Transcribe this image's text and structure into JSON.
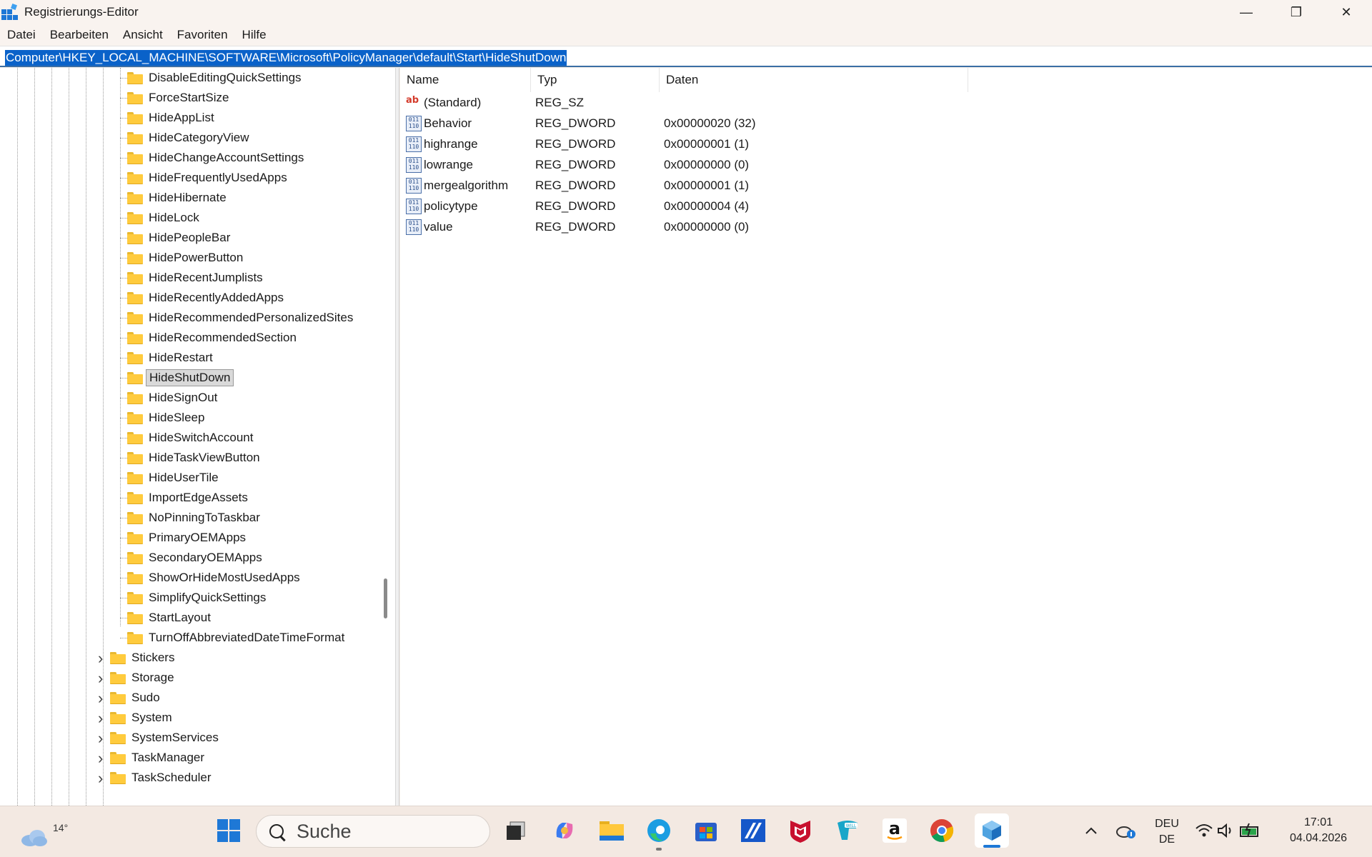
{
  "window": {
    "title": "Registrierungs-Editor",
    "controls": {
      "minimize": "—",
      "restore": "❐",
      "close": "✕"
    }
  },
  "menu": [
    "Datei",
    "Bearbeiten",
    "Ansicht",
    "Favoriten",
    "Hilfe"
  ],
  "address": "Computer\\HKEY_LOCAL_MACHINE\\SOFTWARE\\Microsoft\\PolicyManager\\default\\Start\\HideShutDown",
  "tree": {
    "children": [
      "DisableEditingQuickSettings",
      "ForceStartSize",
      "HideAppList",
      "HideCategoryView",
      "HideChangeAccountSettings",
      "HideFrequentlyUsedApps",
      "HideHibernate",
      "HideLock",
      "HidePeopleBar",
      "HidePowerButton",
      "HideRecentJumplists",
      "HideRecentlyAddedApps",
      "HideRecommendedPersonalizedSites",
      "HideRecommendedSection",
      "HideRestart",
      "HideShutDown",
      "HideSignOut",
      "HideSleep",
      "HideSwitchAccount",
      "HideTaskViewButton",
      "HideUserTile",
      "ImportEdgeAssets",
      "NoPinningToTaskbar",
      "PrimaryOEMApps",
      "SecondaryOEMApps",
      "ShowOrHideMostUsedApps",
      "SimplifyQuickSettings",
      "StartLayout",
      "TurnOffAbbreviatedDateTimeFormat"
    ],
    "selected": "HideShutDown",
    "siblings": [
      "Stickers",
      "Storage",
      "Sudo",
      "System",
      "SystemServices",
      "TaskManager",
      "TaskScheduler"
    ]
  },
  "columns": {
    "name": "Name",
    "type": "Typ",
    "data": "Daten"
  },
  "values": [
    {
      "name": "(Standard)",
      "type": "REG_SZ",
      "data": "",
      "icon": "string-value-icon"
    },
    {
      "name": "Behavior",
      "type": "REG_DWORD",
      "data": "0x00000020 (32)",
      "icon": "dword-value-icon"
    },
    {
      "name": "highrange",
      "type": "REG_DWORD",
      "data": "0x00000001 (1)",
      "icon": "dword-value-icon"
    },
    {
      "name": "lowrange",
      "type": "REG_DWORD",
      "data": "0x00000000 (0)",
      "icon": "dword-value-icon"
    },
    {
      "name": "mergealgorithm",
      "type": "REG_DWORD",
      "data": "0x00000001 (1)",
      "icon": "dword-value-icon"
    },
    {
      "name": "policytype",
      "type": "REG_DWORD",
      "data": "0x00000004 (4)",
      "icon": "dword-value-icon"
    },
    {
      "name": "value",
      "type": "REG_DWORD",
      "data": "0x00000000 (0)",
      "icon": "dword-value-icon"
    }
  ],
  "taskbar": {
    "weather": {
      "temperature": "14°",
      "icon": "cloud-icon"
    },
    "search_placeholder": "Suche",
    "apps": [
      {
        "name": "task-view",
        "icon": "task-view-icon"
      },
      {
        "name": "copilot",
        "icon": "copilot-icon"
      },
      {
        "name": "file-explorer",
        "icon": "folder-icon"
      },
      {
        "name": "edge",
        "icon": "edge-icon"
      },
      {
        "name": "store",
        "icon": "store-icon"
      },
      {
        "name": "app-blue",
        "icon": "blue-app-icon"
      },
      {
        "name": "mcafee",
        "icon": "mcafee-icon"
      },
      {
        "name": "will-app",
        "icon": "will-icon"
      },
      {
        "name": "amazon",
        "icon": "amazon-icon"
      },
      {
        "name": "chrome",
        "icon": "chrome-icon"
      },
      {
        "name": "regedit",
        "icon": "regedit-icon"
      }
    ],
    "tray": {
      "language_line1": "DEU",
      "language_line2": "DE",
      "time": "17:01",
      "date": "04.04.2026"
    }
  },
  "colors": {
    "selection": "#0a62c9",
    "folder": "#ffcb3d",
    "accent": "#1e78d6"
  }
}
